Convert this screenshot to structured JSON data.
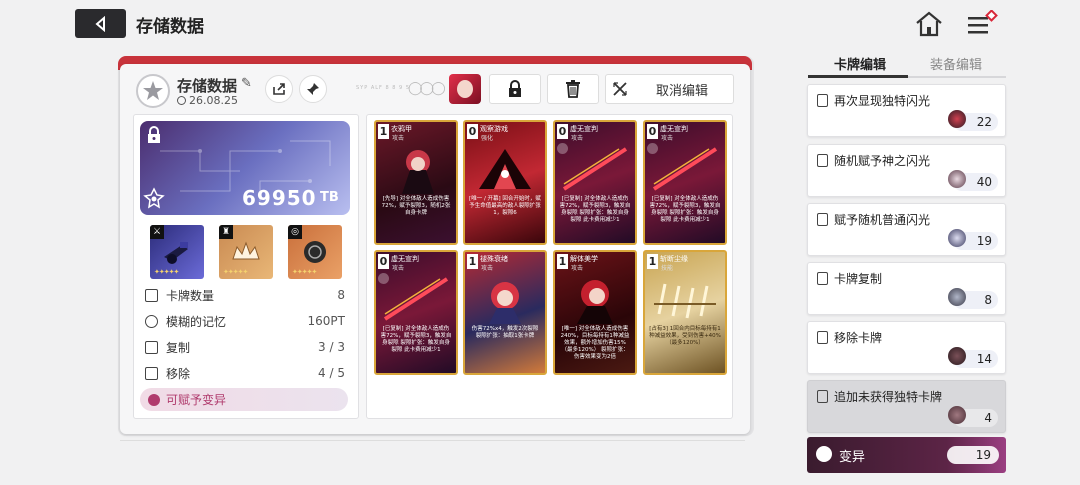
{
  "header": {
    "title": "存储数据"
  },
  "save": {
    "name": "存储数据",
    "date": "26.08.25",
    "deco_text": "SYP ALF 8 8 9 5",
    "cancel_edit": "取消编辑"
  },
  "bag": {
    "value": "69950",
    "unit": "TB"
  },
  "equipment": [
    {
      "slot": "weapon",
      "stars": "✦✦✦✦✦"
    },
    {
      "slot": "armor",
      "stars": "✦✦✦✦✦"
    },
    {
      "slot": "ring",
      "stars": "✦✦✦✦✦"
    }
  ],
  "stats": [
    {
      "label": "卡牌数量",
      "value": "8"
    },
    {
      "label": "模糊的记忆",
      "value": "160PT"
    },
    {
      "label": "复制",
      "value": "3 / 3"
    },
    {
      "label": "移除",
      "value": "4 / 5"
    }
  ],
  "mutate_available": "可赋予变异",
  "cards": [
    {
      "cost": "1",
      "name": "衣鸦甲",
      "type": "攻击",
      "desc": "[先导] 对全体敌人造成伤害72%，赋予裂隙3，随机2张自身卡牌"
    },
    {
      "cost": "0",
      "name": "观察游戏",
      "type": "强化",
      "desc": "[唯一 / 开幕] 回合开始时，赋予生命值最高的敌人裂隙扩张1，裂隙6"
    },
    {
      "cost": "0",
      "name": "虚无宣判",
      "type": "攻击",
      "desc": "[已复制] 对全体敌人造成伤害72%，赋予裂隙3，触发自身裂隙 裂隙扩张：触发自身裂隙 此卡费用减少1"
    },
    {
      "cost": "0",
      "name": "虚无宣判",
      "type": "攻击",
      "desc": "[已复制] 对全体敌人造成伤害72%，赋予裂隙3，触发自身裂隙 裂隙扩张：触发自身裂隙 此卡费用减少1"
    },
    {
      "cost": "0",
      "name": "虚无宣判",
      "type": "攻击",
      "desc": "[已复制] 对全体敌人造成伤害72%，赋予裂隙3，触发自身裂隙 裂隙扩张：触发自身裂隙 此卡费用减少1"
    },
    {
      "cost": "1",
      "name": "褪殊衰绪",
      "type": "攻击",
      "desc": "伤害72%x4，触发2次裂隙 裂隙扩张：抽取1张卡牌"
    },
    {
      "cost": "1",
      "name": "解体美学",
      "type": "攻击",
      "desc": "[唯一] 对全体敌人造成伤害240%，目标每持有1种减益效果，额外增加伤害15%（最多120%） 裂隙扩张：伤害效果变为2倍"
    },
    {
      "cost": "1",
      "name": "斩断尘缘",
      "type": "技能",
      "desc": "[占有3] 1回合内目标每持有1种减益效果，受到伤害+40%（最多120%）"
    }
  ],
  "right_tabs": [
    "卡牌编辑",
    "装备编辑"
  ],
  "right_items": [
    {
      "label": "再次显现独特闪光",
      "count": "22"
    },
    {
      "label": "随机赋予神之闪光",
      "count": "40"
    },
    {
      "label": "赋予随机普通闪光",
      "count": "19"
    },
    {
      "label": "卡牌复制",
      "count": "8"
    },
    {
      "label": "移除卡牌",
      "count": "14"
    },
    {
      "label": "追加未获得独特卡牌",
      "count": "4"
    }
  ],
  "mutate": {
    "label": "变异",
    "count": "19"
  },
  "colors": {
    "accent_red": "#c8333b",
    "mutate_purple": "#5c2446",
    "dark_button": "#2a2a2d"
  }
}
